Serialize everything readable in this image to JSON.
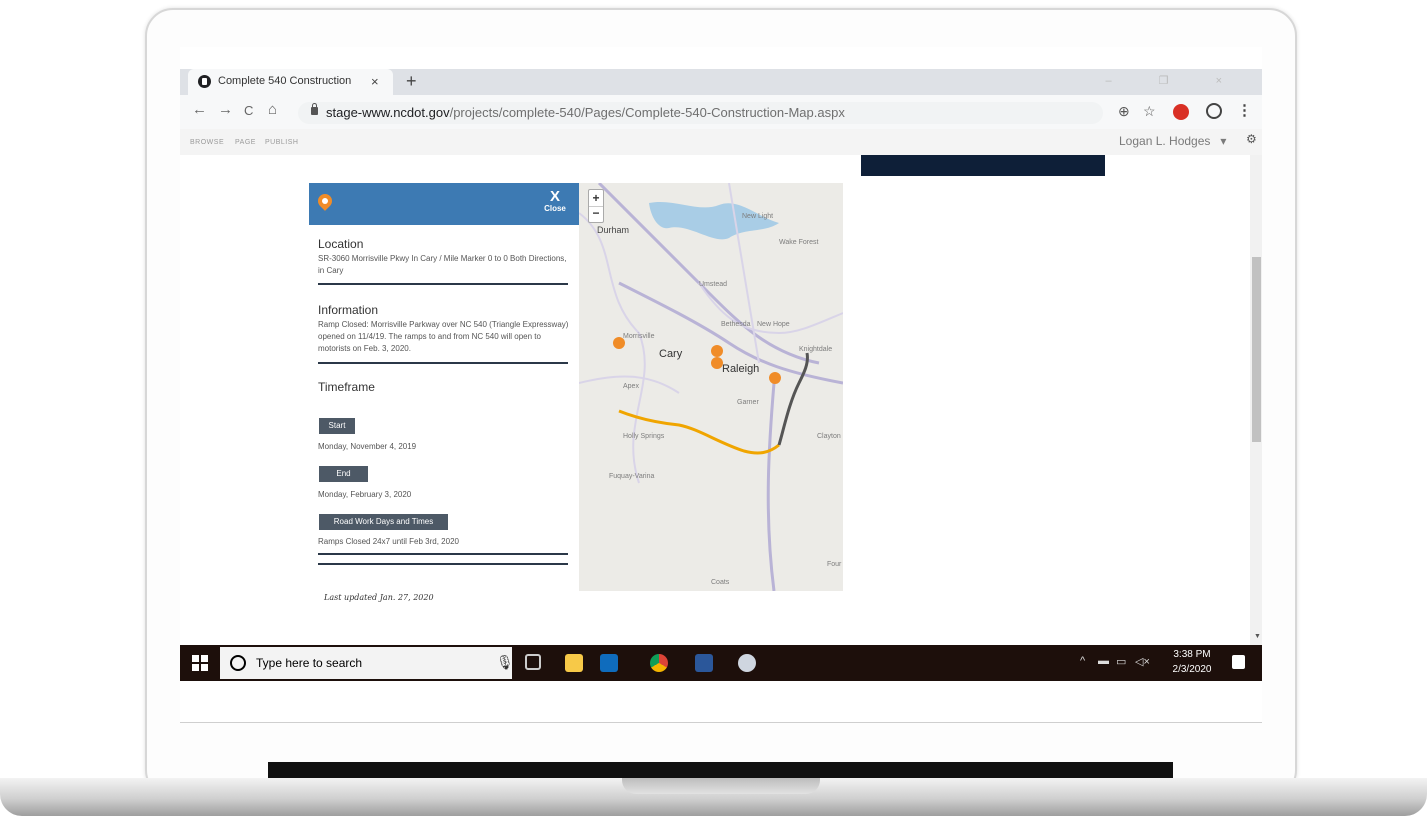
{
  "browser": {
    "tab_title": "Complete 540 Construction",
    "tab_close": "×",
    "new_tab": "+",
    "window_controls": "– ❐ ×",
    "nav": {
      "back": "←",
      "forward": "→",
      "reload": "C",
      "home": "⌂"
    },
    "url_domain": "stage-www.ncdot.gov",
    "url_path": "/projects/complete-540/Pages/Complete-540-Construction-Map.aspx",
    "zoom_icon": "⊕",
    "star_icon": "☆",
    "menu": "⋮"
  },
  "ribbon": {
    "items": [
      "BROWSE",
      "PAGE",
      "PUBLISH"
    ],
    "user": "Logan L. Hodges",
    "user_caret": "▾",
    "gear": "⚙"
  },
  "panel": {
    "close_x": "X",
    "close_label": "Close",
    "location_heading": "Location",
    "location_body": "SR-3060 Morrisville Pkwy In Cary / Mile Marker 0 to 0 Both Directions, in Cary",
    "information_heading": "Information",
    "information_body": "Ramp Closed: Morrisville Parkway over NC 540 (Triangle Expressway) opened on 11/4/19. The ramps to and from NC 540 will open to motorists on Feb. 3, 2020.",
    "timeframe_heading": "Timeframe",
    "start_label": "Start",
    "start_date": "Monday, November 4, 2019",
    "end_label": "End",
    "end_date": "Monday, February 3, 2020",
    "roadwork_label": "Road Work Days and Times",
    "roadwork_text": "Ramps Closed 24x7 until Feb 3rd, 2020",
    "last_updated": "Last updated Jan. 27, 2020"
  },
  "map": {
    "zoom_in": "+",
    "zoom_out": "−",
    "labels": {
      "durham": "Durham",
      "new_light": "New Light",
      "wake_forest": "Wake Forest",
      "morrisville": "Morrisville",
      "cary": "Cary",
      "raleigh": "Raleigh",
      "bethesda": "Bethesda",
      "new_hope": "New Hope",
      "knightdale": "Knightdale",
      "apex": "Apex",
      "garner": "Garner",
      "holly_springs": "Holly Springs",
      "fuquay_varina": "Fuquay-Varina",
      "clayton": "Clayton",
      "four_oaks": "Four",
      "coats": "Coats",
      "umstead": "Umstead"
    },
    "colors": {
      "construction_route": "#f0a500",
      "completed_route": "#555555",
      "marker": "#f08c28",
      "water": "#a9cde6",
      "interstate": "#b9b3d6"
    }
  },
  "taskbar": {
    "search_placeholder": "Type here to search",
    "time": "3:38 PM",
    "date": "2/3/2020",
    "tray_caret": "^",
    "notification_count": "1"
  }
}
